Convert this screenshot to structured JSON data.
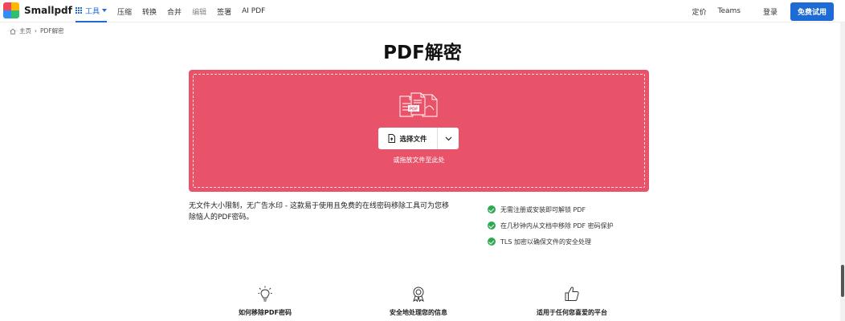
{
  "brand": {
    "name": "Smallpdf"
  },
  "nav": {
    "tools_label": "工具",
    "items": [
      "压缩",
      "转换",
      "合并",
      "编辑",
      "签署",
      "AI PDF"
    ]
  },
  "right_nav": {
    "pricing": "定价",
    "teams": "Teams",
    "login": "登录",
    "try_free": "免费试用"
  },
  "breadcrumb": {
    "home": "主页",
    "sep": "›",
    "current": "PDF解密"
  },
  "page": {
    "title": "PDF解密"
  },
  "dropzone": {
    "select_label": "选择文件",
    "hint": "或拖放文件至此处",
    "doc_label": "PDF"
  },
  "description": "无文件大小限制，无广告水印 - 这款易于使用且免费的在线密码移除工具可为您移除恼人的PDF密码。",
  "features": [
    "无需注册或安装即可解锁 PDF",
    "在几秒钟内从文档中移除 PDF 密码保护",
    "TLS 加密以确保文件的安全处理"
  ],
  "cards": [
    {
      "label": "如何移除PDF密码",
      "icon": "lightbulb-icon"
    },
    {
      "label": "安全地处理您的信息",
      "icon": "award-icon"
    },
    {
      "label": "适用于任何您喜爱的平台",
      "icon": "thumbs-up-icon"
    }
  ],
  "colors": {
    "accent": "#1e6bd6",
    "dropzone": "#e8536a",
    "check": "#2fa84f"
  }
}
